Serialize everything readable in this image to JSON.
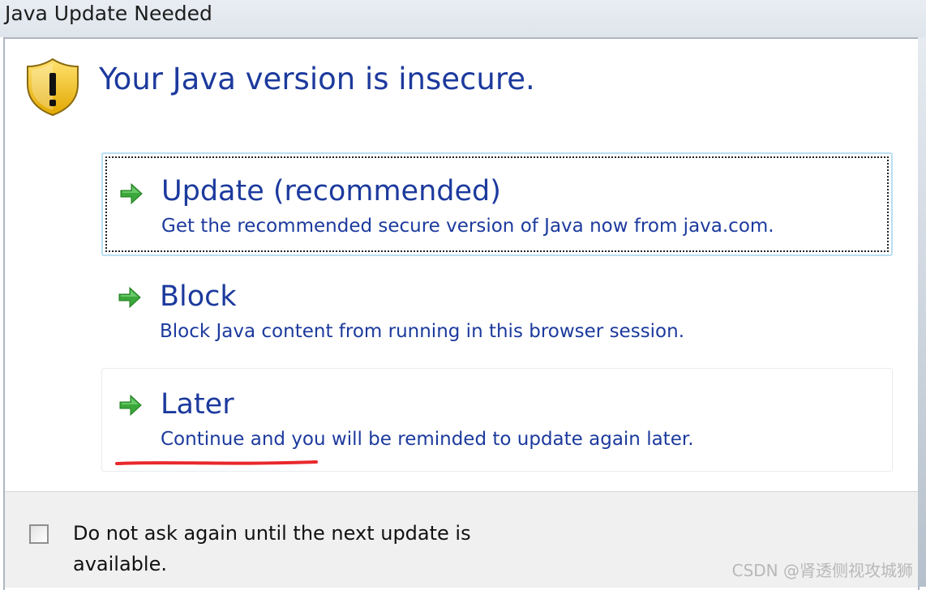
{
  "window": {
    "title": "Java Update Needed"
  },
  "header": {
    "icon": "warning-shield-icon",
    "headline": "Your Java version is insecure."
  },
  "options": [
    {
      "icon": "green-arrow-icon",
      "title": "Update (recommended)",
      "description": "Get the recommended secure version of Java now from java.com."
    },
    {
      "icon": "green-arrow-icon",
      "title": "Block",
      "description": "Block Java content from running in this browser session."
    },
    {
      "icon": "green-arrow-icon",
      "title": "Later",
      "description": "Continue and you will be reminded to update again later."
    }
  ],
  "footer": {
    "checkbox_label": "Do not ask again until the next update is available.",
    "checkbox_checked": false
  },
  "watermark": "CSDN @肾透侧视攻城狮",
  "colors": {
    "link_blue": "#1c3a9d",
    "arrow_green": "#3aa83a",
    "shield_yellow": "#f4c81f",
    "annotation_red": "#e8282b"
  }
}
